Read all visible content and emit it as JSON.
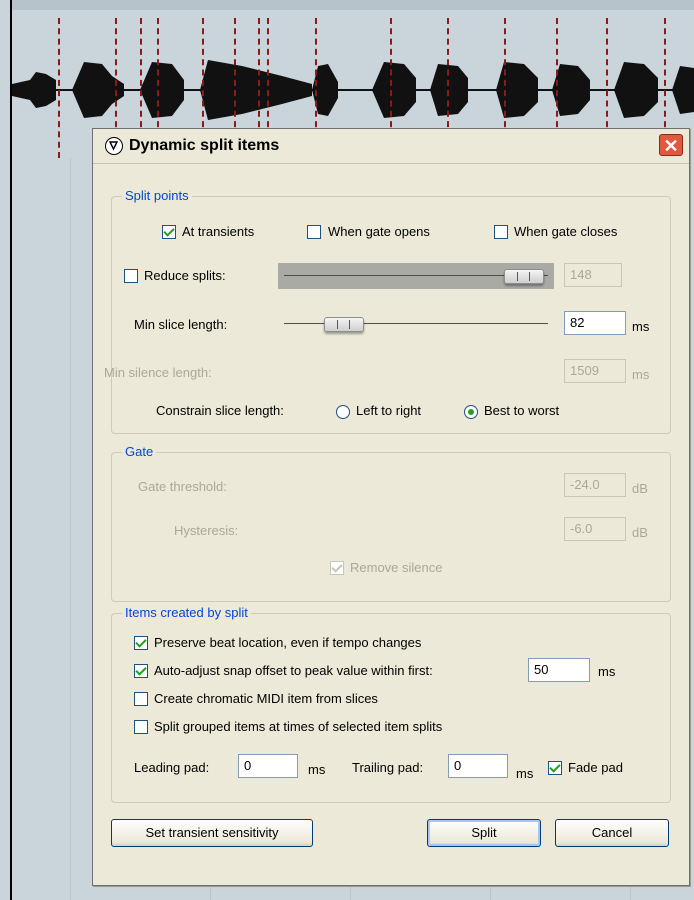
{
  "dialog": {
    "title": "Dynamic split items",
    "close_label": "✕"
  },
  "split_points": {
    "legend": "Split points",
    "at_transients": {
      "label": "At transients",
      "checked": true
    },
    "when_gate_opens": {
      "label": "When gate opens",
      "checked": false
    },
    "when_gate_closes": {
      "label": "When gate closes",
      "checked": false
    },
    "reduce_splits": {
      "label": "Reduce splits:",
      "checked": false,
      "value": "148"
    },
    "min_slice_length": {
      "label": "Min slice length:",
      "value": "82",
      "unit": "ms"
    },
    "min_silence_length": {
      "label": "Min silence length:",
      "value": "1509",
      "unit": "ms"
    },
    "constrain": {
      "label": "Constrain slice length:",
      "options": [
        "Left to right",
        "Best to worst"
      ],
      "selected": "Best to worst"
    }
  },
  "gate": {
    "legend": "Gate",
    "threshold": {
      "label": "Gate threshold:",
      "value": "-24.0",
      "unit": "dB"
    },
    "hysteresis": {
      "label": "Hysteresis:",
      "value": "-6.0",
      "unit": "dB"
    },
    "remove_silence": {
      "label": "Remove silence",
      "checked": true
    }
  },
  "items": {
    "legend": "Items created by split",
    "preserve_beat": {
      "label": "Preserve beat location, even if tempo changes",
      "checked": true
    },
    "auto_adjust": {
      "label": "Auto-adjust snap offset to peak value within first:",
      "checked": true,
      "value": "50",
      "unit": "ms"
    },
    "chromatic_midi": {
      "label": "Create chromatic MIDI item from slices",
      "checked": false
    },
    "split_grouped": {
      "label": "Split grouped items at times of selected item splits",
      "checked": false
    },
    "leading_pad": {
      "label": "Leading pad:",
      "value": "0",
      "unit": "ms"
    },
    "trailing_pad": {
      "label": "Trailing pad:",
      "value": "0",
      "unit": "ms"
    },
    "fade_pad": {
      "label": "Fade pad",
      "checked": true
    }
  },
  "buttons": {
    "transient": "Set transient sensitivity",
    "split": "Split",
    "cancel": "Cancel"
  }
}
